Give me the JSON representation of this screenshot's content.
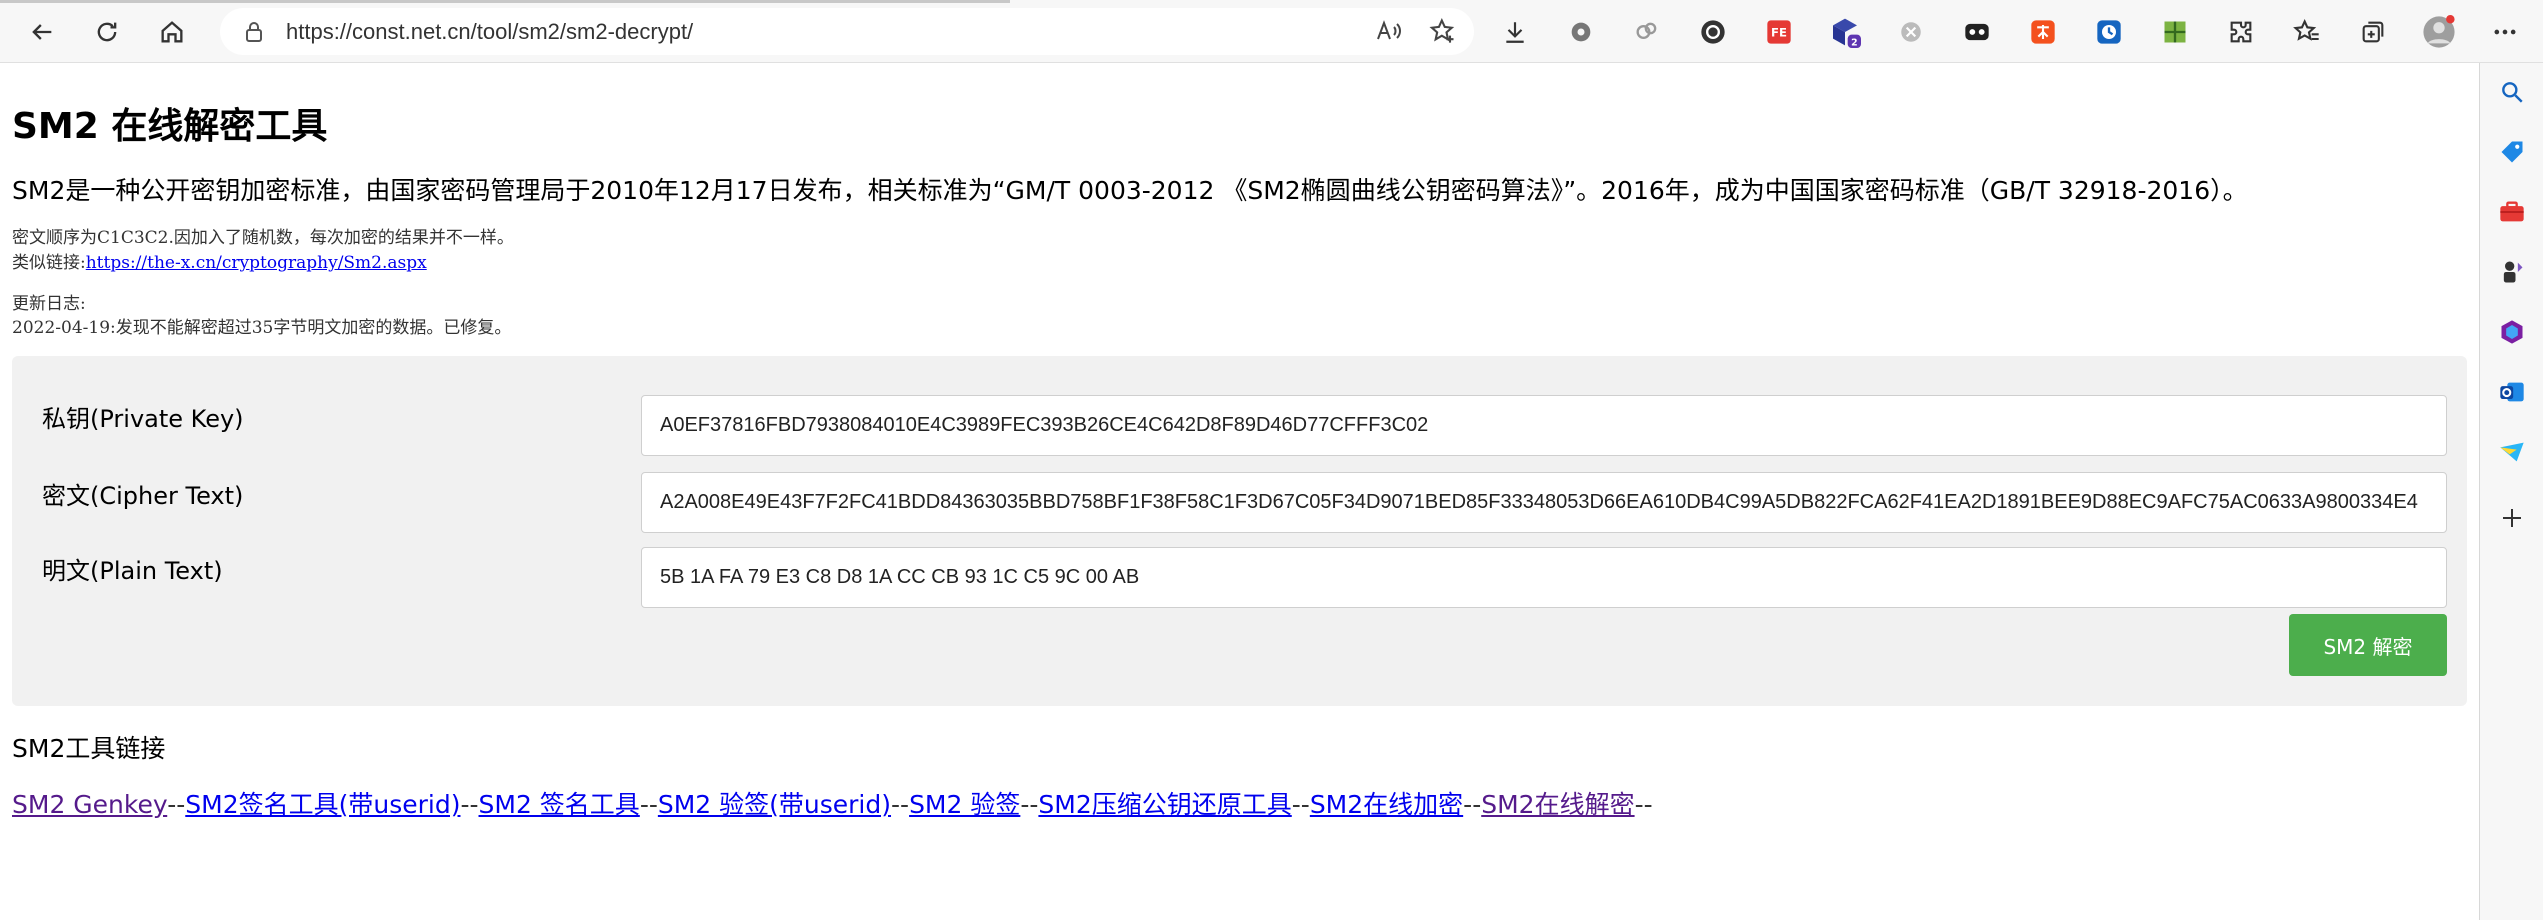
{
  "browser": {
    "url": "https://const.net.cn/tool/sm2/sm2-decrypt/"
  },
  "page": {
    "title": "SM2 在线解密工具",
    "intro": "SM2是一种公开密钥加密标准，由国家密码管理局于2010年12月17日发布，相关标准为“GM/T 0003-2012 《SM2椭圆曲线公钥密码算法》”。2016年，成为中国国家密码标准（GB/T 32918-2016）。",
    "note_line1": "密文顺序为C1C3C2.因加入了随机数，每次加密的结果并不一样。",
    "note_line2_prefix": "类似链接:",
    "note_line2_link": "https://the-x.cn/cryptography/Sm2.aspx",
    "changelog_title": "更新日志:",
    "changelog_entry": "2022-04-19:发现不能解密超过35字节明文加密的数据。已修复。"
  },
  "form": {
    "private_key_label": "私钥(Private Key)",
    "private_key_value": "A0EF37816FBD7938084010E4C3989FEC393B26CE4C642D8F89D46D77CFFF3C02",
    "cipher_label": "密文(Cipher Text)",
    "cipher_value": "A2A008E49E43F7F2FC41BDD84363035BBD758BF1F38F58C1F3D67C05F34D9071BED85F33348053D66EA610DB4C99A5DB822FCA62F41EA2D1891BEE9D88EC9AFC75AC0633A9800334E4",
    "plain_label": "明文(Plain Text)",
    "plain_value": "5B 1A FA 79 E3 C8 D8 1A CC CB 93 1C C5 9C 00 AB",
    "decrypt_button": "SM2 解密"
  },
  "tools": {
    "title": "SM2工具链接",
    "links": [
      {
        "label": "SM2 Genkey",
        "visited": true
      },
      {
        "label": "SM2签名工具(带userid)",
        "visited": false
      },
      {
        "label": "SM2 签名工具",
        "visited": false
      },
      {
        "label": "SM2 验签(带userid)",
        "visited": false
      },
      {
        "label": "SM2 验签",
        "visited": false
      },
      {
        "label": "SM2压缩公钥还原工具",
        "visited": false
      },
      {
        "label": "SM2在线加密",
        "visited": false
      },
      {
        "label": "SM2在线解密",
        "visited": true
      }
    ],
    "separator": "--"
  },
  "colors": {
    "button_green": "#4cae4c",
    "link_blue": "#0000ee",
    "link_visited": "#551a8b",
    "panel_bg": "#f1f1f1"
  }
}
